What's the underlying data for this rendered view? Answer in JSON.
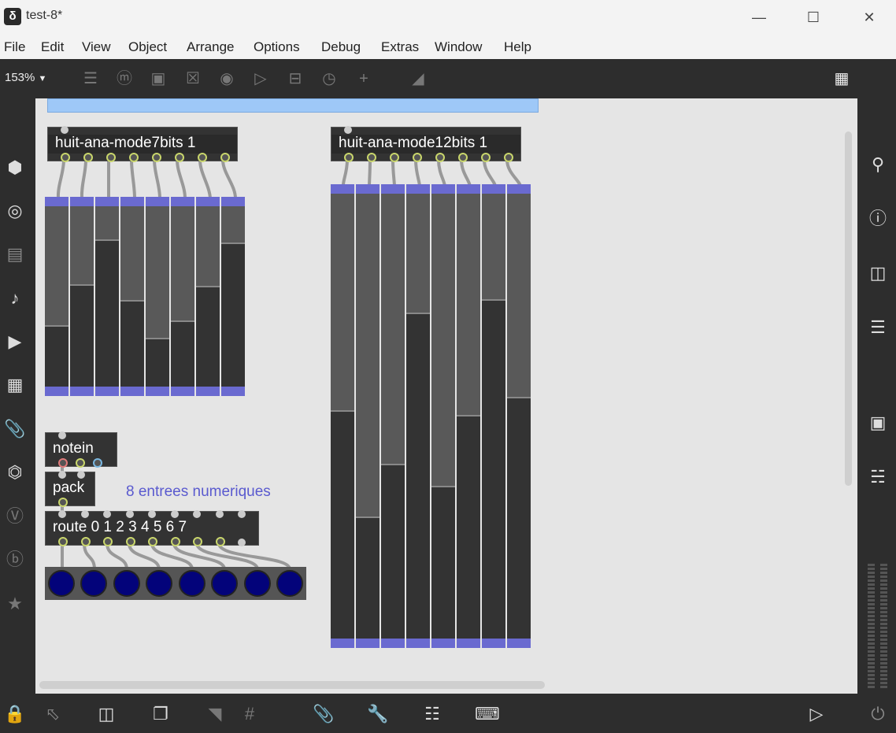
{
  "window": {
    "title": "test-8*",
    "logo": "max-logo-icon",
    "minimize": "—",
    "maximize": "☐",
    "close": "✕"
  },
  "menu": [
    "File",
    "Edit",
    "View",
    "Object",
    "Arrange",
    "Options",
    "Debug",
    "Extras",
    "Window",
    "Help"
  ],
  "toolbar": {
    "zoom": "153%",
    "zoom_arrow": "▼"
  },
  "patch": {
    "objects": {
      "mode7": "huit-ana-mode7bits 1",
      "mode12": "huit-ana-mode12bits 1",
      "notein": "notein",
      "pack": "pack",
      "route": "route 0 1 2 3 4 5 6 7"
    },
    "comment": "8 entrees numeriques",
    "multislider_7bits": [
      0.33,
      0.56,
      0.81,
      0.47,
      0.26,
      0.36,
      0.55,
      0.79
    ],
    "multislider_12bits": [
      0.51,
      0.27,
      0.39,
      0.73,
      0.34,
      0.5,
      0.76,
      0.54
    ]
  },
  "colors": {
    "canvas": "#e5e5e5",
    "slider_bg": "#595959",
    "slider_fill": "#333333",
    "slider_cap": "#6a6ad0",
    "comment": "#5a5acf",
    "led": "#03037a"
  }
}
